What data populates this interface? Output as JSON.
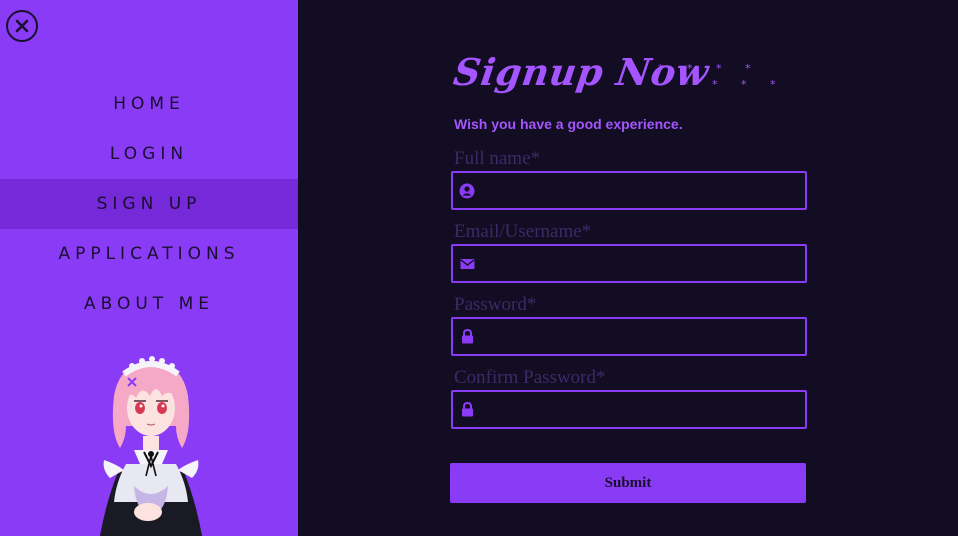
{
  "sidebar": {
    "close_icon": "close-icon",
    "nav": [
      {
        "label": "HOME",
        "active": false
      },
      {
        "label": "LOGIN",
        "active": false
      },
      {
        "label": "SIGN UP",
        "active": true
      },
      {
        "label": "APPLICATIONS",
        "active": false
      },
      {
        "label": "ABOUT ME",
        "active": false
      }
    ]
  },
  "form": {
    "title": "Signup Now",
    "stars_row1": "* * * *",
    "stars_row2": "* * * * *",
    "subtitle": "Wish you have a good experience.",
    "fields": [
      {
        "label": "Full name*",
        "icon": "user-icon",
        "value": ""
      },
      {
        "label": "Email/Username*",
        "icon": "envelope-icon",
        "value": ""
      },
      {
        "label": "Password*",
        "icon": "lock-icon",
        "value": ""
      },
      {
        "label": "Confirm Password*",
        "icon": "lock-icon",
        "value": ""
      }
    ],
    "submit_label": "Submit"
  },
  "colors": {
    "accent": "#8a3bf5",
    "active_nav": "#7529d9",
    "background": "#120d22",
    "heading": "#a455ff",
    "label": "#3b2a66"
  }
}
